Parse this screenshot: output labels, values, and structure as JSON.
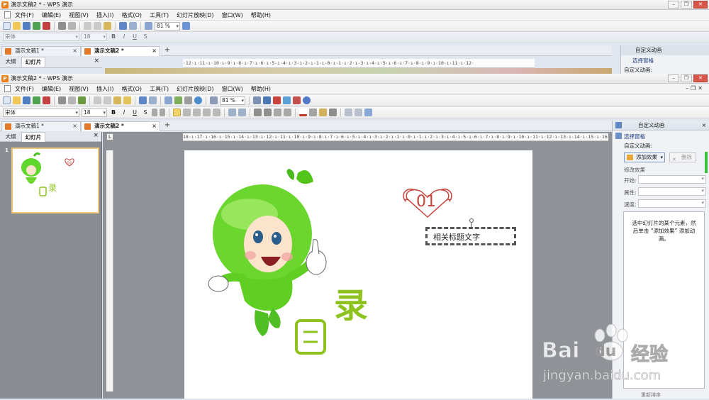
{
  "app": {
    "title": "演示文稿2 * - WPS 演示",
    "window_buttons": [
      "–",
      "❐",
      "✕"
    ]
  },
  "menu": {
    "items": [
      "文件(F)",
      "编辑(E)",
      "视图(V)",
      "插入(I)",
      "格式(O)",
      "工具(T)",
      "幻灯片放映(D)",
      "窗口(W)",
      "帮助(H)"
    ]
  },
  "toolbar": {
    "zoom": "81 %",
    "font_name_back": "宋体",
    "font_size_back": "18",
    "font_name": "宋体",
    "font_size": "18",
    "format_buttons": [
      "B",
      "I",
      "U",
      "S"
    ]
  },
  "tabs": {
    "back": [
      {
        "label": "演示文稿1 *"
      },
      {
        "label": "演示文稿2 *"
      }
    ],
    "front": [
      {
        "label": "演示文稿1 *"
      },
      {
        "label": "演示文稿2 *"
      }
    ],
    "plus": "+"
  },
  "left_pane": {
    "tab_outline": "大纲",
    "tab_slides": "幻灯片",
    "close": "×",
    "slide_number": "1"
  },
  "ruler": {
    "top": "·12·ı·11·ı·10·ı·9·ı·8·ı·7·ı·6·ı·5·ı·4·ı·3·ı·2·ı·1·ı·0·ı·1·ı·2·ı·3·ı·4·ı·5·ı·6·ı·7·ı·8·ı·9·ı·10·ı·11·ı·12·",
    "main": "18·ı·17·ı·16·ı·15·ı·14·ı·13·ı·12·ı·11·ı·10·ı·9·ı·8·ı·7·ı·6·ı·5·ı·4·ı·3·ı·2·ı·1·ı·0·ı·1·ı·2·ı·3·ı·4·ı·5·ı·6·ı·7·ı·8·ı·9·ı·10·ı·11·ı·12·ı·13·ı·14·ı·15·ı·16·ı·17·ı·18"
  },
  "task_pane": {
    "title": "自定义动画",
    "select_pane": "选择窗格",
    "custom_animation": "自定义动画:",
    "add_effect": "添加效果",
    "delete": "删除",
    "modify_effect": "修改效果",
    "start_label": "开始:",
    "property_label": "属性:",
    "speed_label": "速度:",
    "hint": "选中幻灯片的某个元素，然后单击 “添加效果” 添加动画。",
    "bottom_button": "重新排序"
  },
  "slide": {
    "heart_number": "01",
    "title_text": "相关标题文字",
    "char_mu": "目",
    "char_lu": "录"
  },
  "watermark": {
    "brand": "Bai",
    "brand2": "du",
    "cn": "经验",
    "url": "jingyan.baidu.com"
  },
  "colors": {
    "green": "#8dc21f",
    "heart_red": "#c8433c",
    "accent_orange": "#e07a2a"
  }
}
